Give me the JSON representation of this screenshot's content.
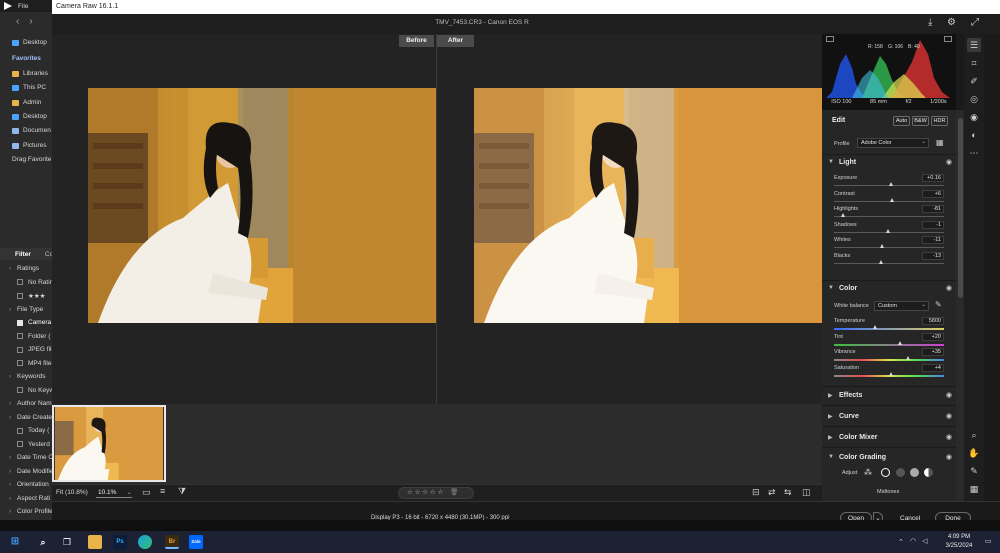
{
  "app": {
    "window_title": "Camera Raw 16.1.1",
    "file_title": "TMV_7453.CR3  -  Canon EOS R",
    "before_label": "Before",
    "after_label": "After"
  },
  "explorer": {
    "menu_label": "File",
    "nav_items": [
      {
        "label": "Desktop",
        "color": "#4aa3ff"
      },
      {
        "label": "Favorites",
        "heading": true
      },
      {
        "label": "Libraries",
        "color": "#e8b44a"
      },
      {
        "label": "This PC",
        "color": "#4aa3ff"
      },
      {
        "label": "Admin",
        "color": "#e8b44a"
      },
      {
        "label": "Desktop",
        "color": "#4aa3ff"
      },
      {
        "label": "Documen",
        "color": "#8fb8e8"
      },
      {
        "label": "Pictures",
        "color": "#8fb8e8"
      },
      {
        "label": "Drag Favorite"
      }
    ],
    "filter_tabs": [
      "Filter",
      "Co"
    ],
    "filters": [
      {
        "label": "Ratings",
        "type": "group"
      },
      {
        "label": "No Ratin",
        "type": "check",
        "checked": false
      },
      {
        "label": "★★★",
        "type": "check",
        "checked": false
      },
      {
        "label": "File Type",
        "type": "group"
      },
      {
        "label": "Camera",
        "type": "check",
        "checked": true
      },
      {
        "label": "Folder (",
        "type": "check",
        "checked": false
      },
      {
        "label": "JPEG file",
        "type": "check",
        "checked": false
      },
      {
        "label": "MP4 file",
        "type": "check",
        "checked": false
      },
      {
        "label": "Keywords",
        "type": "group"
      },
      {
        "label": "No Keyw",
        "type": "check",
        "checked": false
      },
      {
        "label": "Author Nam",
        "type": "group"
      },
      {
        "label": "Date Create",
        "type": "group"
      },
      {
        "label": "Today (",
        "type": "check",
        "checked": false
      },
      {
        "label": "Yesterd",
        "type": "check",
        "checked": false
      },
      {
        "label": "Date Time O",
        "type": "group"
      },
      {
        "label": "Date Modifie",
        "type": "group"
      },
      {
        "label": "Orientation",
        "type": "group"
      },
      {
        "label": "Aspect Rati",
        "type": "group"
      },
      {
        "label": "Color Profile",
        "type": "group"
      }
    ]
  },
  "histogram": {
    "rgb_readout": [
      "R: 158",
      "G: 106",
      "B: 40"
    ],
    "camera_info": [
      "ISO 100",
      "85 mm",
      "f/2",
      "1/200s"
    ]
  },
  "edit": {
    "title": "Edit",
    "auto_label": "Auto",
    "bw_label": "B&W",
    "hdr_label": "HDR",
    "profile_label": "Profile",
    "profile_value": "Adobe Color",
    "light": {
      "title": "Light",
      "sliders": [
        {
          "label": "Exposure",
          "value": "+0.16",
          "pos": 0.52
        },
        {
          "label": "Contrast",
          "value": "+6",
          "pos": 0.53
        },
        {
          "label": "Highlights",
          "value": "-81",
          "pos": 0.09
        },
        {
          "label": "Shadows",
          "value": "-1",
          "pos": 0.495
        },
        {
          "label": "Whites",
          "value": "-11",
          "pos": 0.445
        },
        {
          "label": "Blacks",
          "value": "-13",
          "pos": 0.435
        }
      ]
    },
    "color": {
      "title": "Color",
      "white_balance_label": "White balance",
      "white_balance_value": "Custom",
      "sliders": [
        {
          "label": "Temperature",
          "value": "5800",
          "pos": 0.38,
          "gradient": "linear-gradient(90deg,#3a6cff,#e0d060)"
        },
        {
          "label": "Tint",
          "value": "+20",
          "pos": 0.6,
          "gradient": "linear-gradient(90deg,#3cc040,#d040d0)"
        },
        {
          "label": "Vibrance",
          "value": "+35",
          "pos": 0.675,
          "gradient": "linear-gradient(90deg,#888,#e05050,#e0e050,#50e050,#5080e0)"
        },
        {
          "label": "Saturation",
          "value": "+4",
          "pos": 0.52,
          "gradient": "linear-gradient(90deg,#888,#e05050,#e0e050,#50e050,#5080e0)"
        }
      ]
    },
    "collapsed_sections": [
      "Effects",
      "Curve",
      "Color Mixer"
    ],
    "color_grading": {
      "title": "Color Grading",
      "adjust_label": "Adjust",
      "midtones_label": "Midtones"
    }
  },
  "bottom": {
    "zoom_fit": "Fit (10.8%)",
    "zoom_value": "10.1%",
    "rating": "☆ ☆ ☆ ☆ ☆",
    "workflow": "Display P3 - 16 bit - 6720 x 4480 (30.1MP) - 300 ppi",
    "open_label": "Open",
    "cancel_label": "Cancel",
    "done_label": "Done"
  },
  "taskbar": {
    "time": "4:09 PM",
    "date": "3/25/2024",
    "apps": [
      "Ps",
      "Br",
      "Zalo"
    ]
  },
  "colors": {
    "accent": "#4aa3ff",
    "panel": "#262626",
    "wall_orange": "#c98a2c"
  }
}
